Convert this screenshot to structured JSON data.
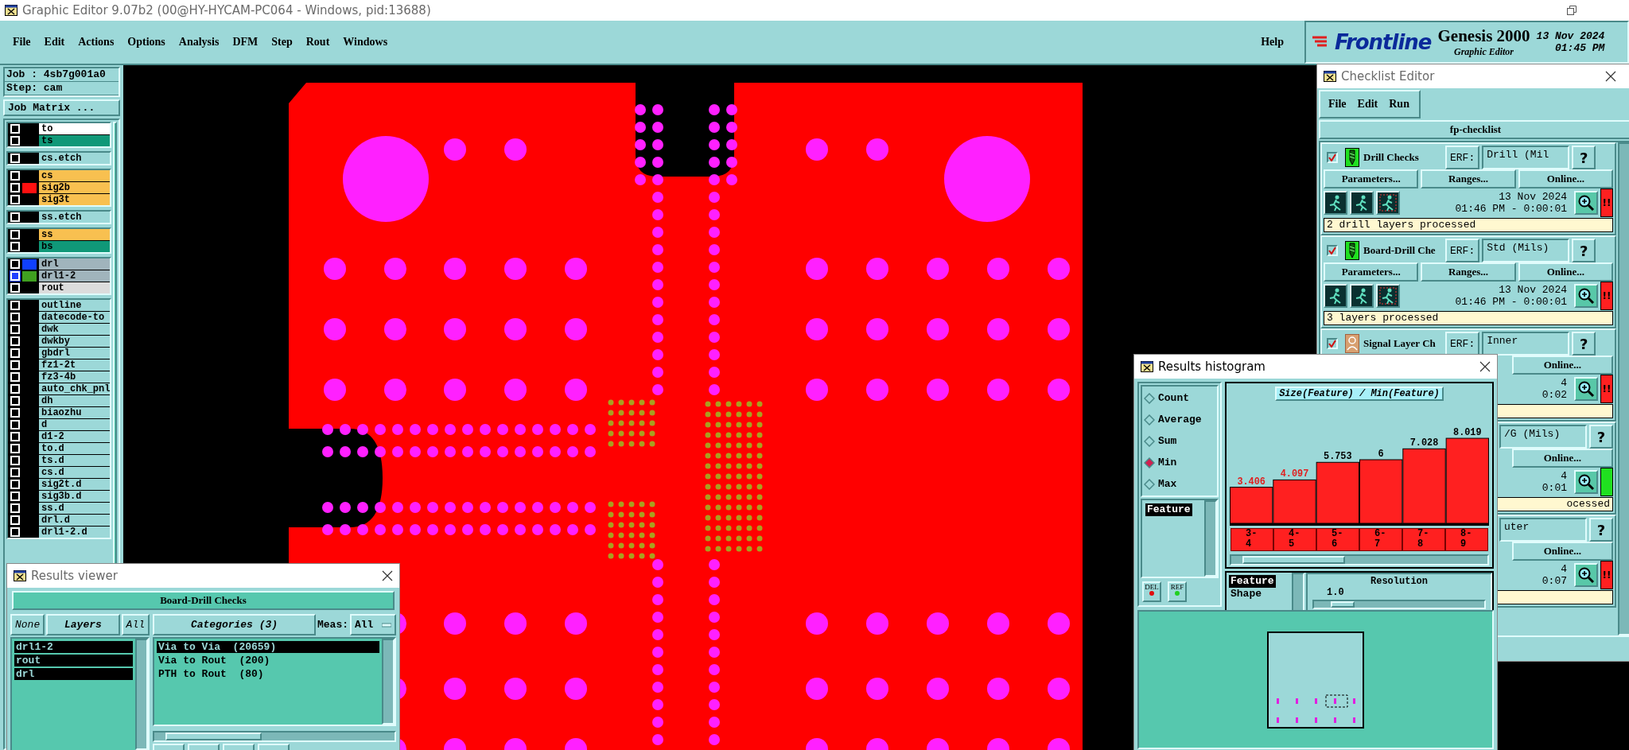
{
  "window": {
    "title": "Graphic Editor 9.07b2 (00@HY-HYCAM-PC064 - Windows, pid:13688)"
  },
  "menu": [
    "File",
    "Edit",
    "Actions",
    "Options",
    "Analysis",
    "DFM",
    "Step",
    "Rout",
    "Windows"
  ],
  "help_menu": "Help",
  "branding": {
    "logo": "Frontline",
    "product": "Genesis 2000",
    "module": "Graphic Editor",
    "date": "13 Nov 2024",
    "time": "01:45 PM"
  },
  "job_panel": {
    "job": "Job : 4sb7g001a0",
    "step": "Step: cam",
    "matrix_button": "Job Matrix ..."
  },
  "layer_groups": [
    {
      "layers": [
        {
          "name": "to",
          "color": "#ffffff",
          "selected": false
        },
        {
          "name": "ts",
          "color": "#109878",
          "selected": false
        }
      ]
    },
    {
      "layers": [
        {
          "name": "cs.etch",
          "color": "#9cd8d8",
          "selected": false
        }
      ]
    },
    {
      "layers": [
        {
          "name": "cs",
          "color": "#f8c050",
          "selected": false
        },
        {
          "name": "sig2b",
          "color": "#f8c050",
          "swatch": {
            "color": "#ff1010"
          },
          "selected": false
        },
        {
          "name": "sig3t",
          "color": "#f8c050",
          "selected": false
        }
      ]
    },
    {
      "layers": [
        {
          "name": "ss.etch",
          "color": "#9cd8d8",
          "selected": false
        }
      ]
    },
    {
      "layers": [
        {
          "name": "ss",
          "color": "#f8c050",
          "selected": false
        },
        {
          "name": "bs",
          "color": "#109878",
          "selected": false
        }
      ]
    },
    {
      "layers": [
        {
          "name": "drl",
          "color": "#a0b4bc",
          "swatch": {
            "color": "#1040ff"
          },
          "selected": false
        },
        {
          "name": "drl1-2",
          "color": "#a0b4bc",
          "swatch": {
            "color": "#40a020"
          },
          "selected": true
        },
        {
          "name": "rout",
          "color": "#dcdcdc",
          "selected": false
        }
      ]
    },
    {
      "layers": [
        {
          "name": "outline",
          "color": "#9cd8d8",
          "selected": false
        },
        {
          "name": "datecode-to",
          "color": "#9cd8d8",
          "selected": false
        },
        {
          "name": "dwk",
          "color": "#9cd8d8",
          "selected": false
        },
        {
          "name": "dwkby",
          "color": "#9cd8d8",
          "selected": false
        },
        {
          "name": "gbdrl",
          "color": "#9cd8d8",
          "selected": false
        },
        {
          "name": "fz1-2t",
          "color": "#9cd8d8",
          "selected": false
        },
        {
          "name": "fz3-4b",
          "color": "#9cd8d8",
          "selected": false
        },
        {
          "name": "auto_chk_pnl",
          "color": "#9cd8d8",
          "selected": false
        },
        {
          "name": "dh",
          "color": "#9cd8d8",
          "selected": false
        },
        {
          "name": "biaozhu",
          "color": "#9cd8d8",
          "selected": false
        },
        {
          "name": "d",
          "color": "#9cd8d8",
          "selected": false
        },
        {
          "name": "d1-2",
          "color": "#9cd8d8",
          "selected": false
        },
        {
          "name": "to.d",
          "color": "#9cd8d8",
          "selected": false
        },
        {
          "name": "ts.d",
          "color": "#9cd8d8",
          "selected": false
        },
        {
          "name": "cs.d",
          "color": "#9cd8d8",
          "selected": false
        },
        {
          "name": "sig2t.d",
          "color": "#9cd8d8",
          "selected": false
        },
        {
          "name": "sig3b.d",
          "color": "#9cd8d8",
          "selected": false
        },
        {
          "name": "ss.d",
          "color": "#9cd8d8",
          "selected": false
        },
        {
          "name": "drl.d",
          "color": "#9cd8d8",
          "selected": false
        },
        {
          "name": "drl1-2.d",
          "color": "#9cd8d8",
          "selected": false
        }
      ]
    }
  ],
  "checklist_editor": {
    "title": "Checklist Editor",
    "active": false,
    "menu": [
      "File",
      "Edit",
      "Run"
    ],
    "checklist": "fp-checklist",
    "checks": [
      {
        "checked": true,
        "kind": "drill",
        "name": "Drill Checks",
        "erf_button": "ERF:",
        "erf": "Drill (Mil",
        "help": "?",
        "buttons": [
          "Parameters...",
          "Ranges...",
          "Online..."
        ],
        "date": "13 Nov 2024",
        "time": "01:46 PM - 0:00:01",
        "passed": false,
        "alert": "!!",
        "message": "2 drill layers processed"
      },
      {
        "checked": true,
        "kind": "drill",
        "name": "Board-Drill Che",
        "erf_button": "ERF:",
        "erf": "Std (Mils)",
        "help": "?",
        "buttons": [
          "Parameters...",
          "Ranges...",
          "Online..."
        ],
        "date": "13 Nov 2024",
        "time": "01:46 PM - 0:00:01",
        "passed": false,
        "alert": "!!",
        "message": "3 layers processed"
      },
      {
        "checked": true,
        "kind": "signal",
        "name": "Signal Layer Ch",
        "erf_button": "ERF:",
        "erf": "Inner",
        "help": "?",
        "buttons": [
          "Online..."
        ],
        "date": "4",
        "time": "0:02",
        "passed": false,
        "alert": "!!"
      },
      {
        "erf": "/G (Mils)",
        "help": "?",
        "buttons": [
          "Online..."
        ],
        "date": "4",
        "time": "0:01",
        "passed": true,
        "message": "ocessed"
      },
      {
        "erf": "uter",
        "help": "?",
        "buttons": [
          "Online..."
        ],
        "date": "4",
        "time": "0:07",
        "passed": false,
        "alert": "!!"
      }
    ]
  },
  "results_histogram": {
    "title": "Results histogram",
    "active": true,
    "modes": [
      {
        "label": "Count",
        "selected": false
      },
      {
        "label": "Average",
        "selected": false
      },
      {
        "label": "Sum",
        "selected": false
      },
      {
        "label": "Min",
        "selected": true
      },
      {
        "label": "Max",
        "selected": false
      }
    ],
    "features": [
      {
        "label": "Feature",
        "selected": true
      }
    ],
    "buttons": [
      "DEL",
      "REF"
    ],
    "chart_data": {
      "type": "bar",
      "title": "Size(Feature) / Min(Feature)",
      "categories": [
        "3-4",
        "4-5",
        "5-6",
        "6-7",
        "7-8",
        "8-9"
      ],
      "values": [
        3.406,
        4.097,
        5.753,
        6,
        7.028,
        8.019
      ],
      "data_labels": true
    },
    "value_labels": [
      "3.406",
      "4.097",
      "5.753",
      "6",
      "7.028",
      "8.019"
    ],
    "group_by": [
      {
        "label": "Feature",
        "selected": true
      },
      {
        "label": "Shape",
        "selected": false
      }
    ],
    "resolution": {
      "label": "Resolution",
      "value": "1.0",
      "level": 0.1
    }
  },
  "results_viewer": {
    "title": "Results viewer",
    "active": false,
    "check": "Board-Drill Checks",
    "layer_buttons": [
      "None",
      "Layers",
      "All"
    ],
    "layers": [
      {
        "name": "drl1-2",
        "selected": true
      },
      {
        "name": "rout",
        "selected": true
      },
      {
        "name": "drl",
        "selected": true
      }
    ],
    "categories_button": "Categories (3)",
    "meas_label": "Meas:",
    "meas_value": "All",
    "categories": [
      {
        "label": "Via to Via  (20659)",
        "selected": true
      },
      {
        "label": "Via to Rout  (200)",
        "selected": false
      },
      {
        "label": "PTH to Rout  (80)",
        "selected": false
      }
    ]
  }
}
